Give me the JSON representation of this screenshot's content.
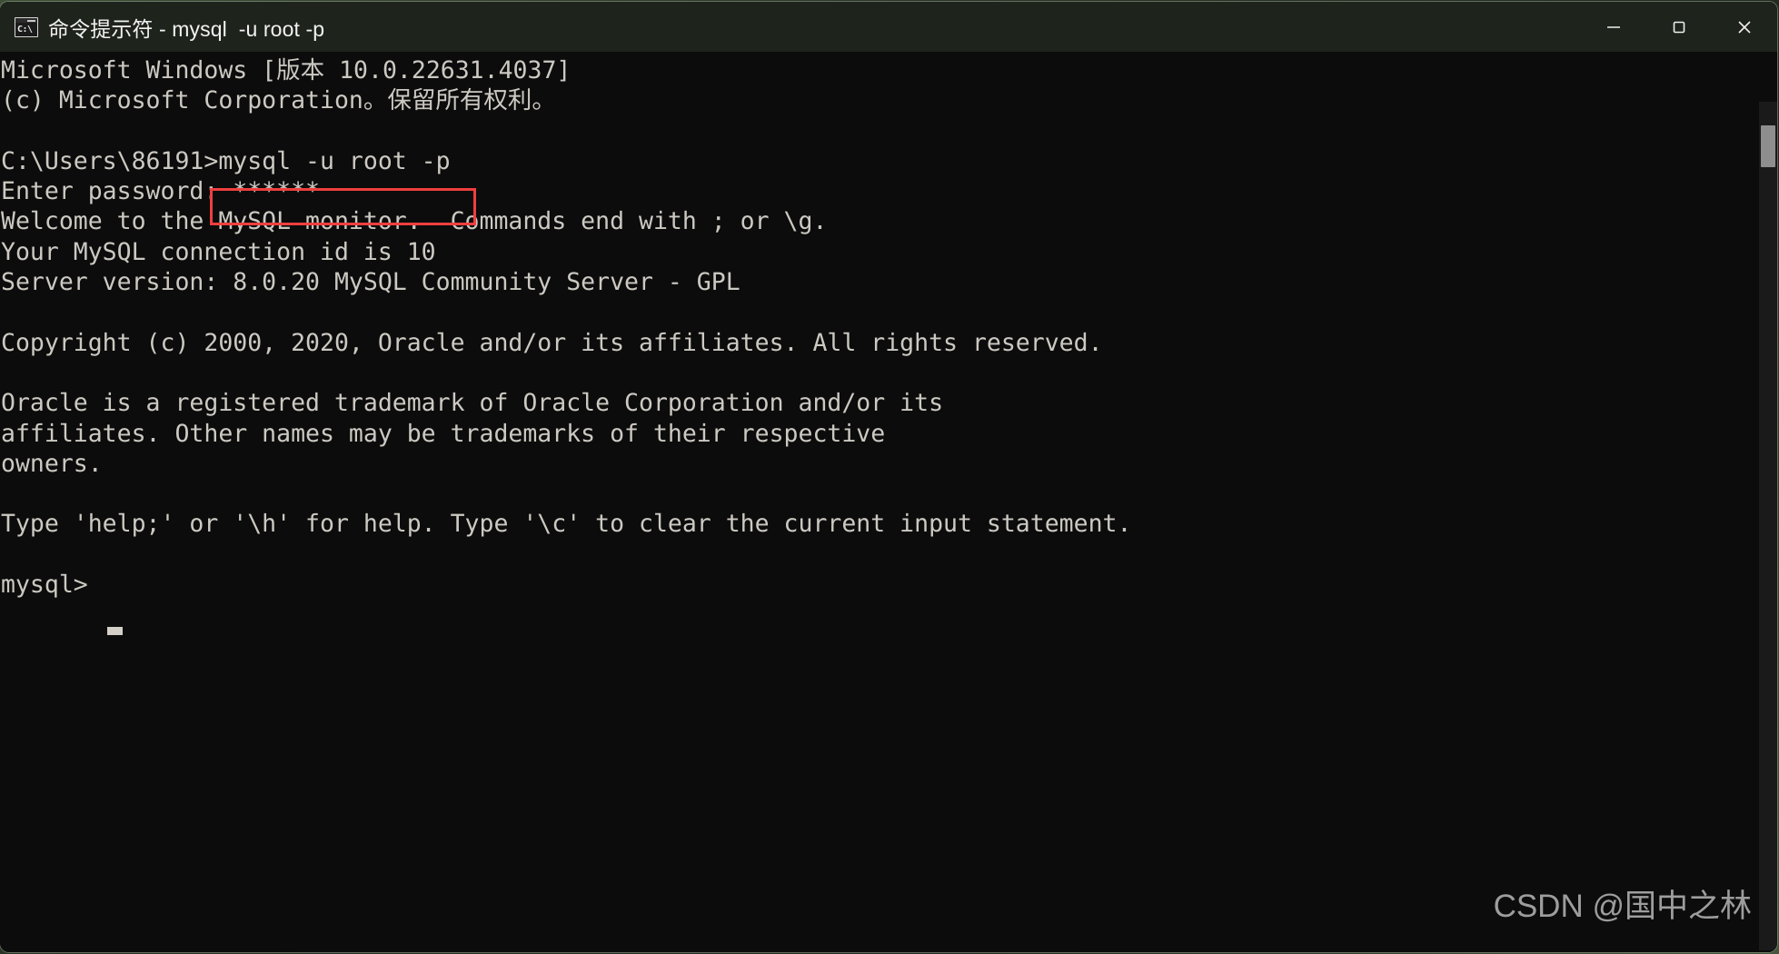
{
  "window": {
    "title": "命令提示符 - mysql  -u root -p",
    "icon": "cmd-prompt-icon",
    "icon_text": "C:\\",
    "controls": {
      "minimize": "minimize-icon",
      "maximize": "maximize-icon",
      "close": "close-icon"
    }
  },
  "terminal": {
    "background_color": "#0c0c0c",
    "foreground_color": "#ccc9c2",
    "lines": [
      "Microsoft Windows [版本 10.0.22631.4037]",
      "(c) Microsoft Corporation。保留所有权利。",
      "",
      "C:\\Users\\86191>mysql -u root -p",
      "Enter password: ******",
      "Welcome to the MySQL monitor.  Commands end with ; or \\g.",
      "Your MySQL connection id is 10",
      "Server version: 8.0.20 MySQL Community Server - GPL",
      "",
      "Copyright (c) 2000, 2020, Oracle and/or its affiliates. All rights reserved.",
      "",
      "Oracle is a registered trademark of Oracle Corporation and/or its",
      "affiliates. Other names may be trademarks of their respective",
      "owners.",
      "",
      "Type 'help;' or '\\h' for help. Type '\\c' to clear the current input statement.",
      "",
      "mysql>"
    ],
    "prompt": "mysql>",
    "cursor": "block-cursor"
  },
  "annotation": {
    "highlight_color": "#ef3f3f",
    "highlighted_command": "mysql -u root -p"
  },
  "scrollbar": {
    "name": "vertical-scrollbar",
    "thumb_color": "#8e8e8e",
    "track_color": "#1a1a1a"
  },
  "watermark": {
    "text": "CSDN @国中之林"
  }
}
